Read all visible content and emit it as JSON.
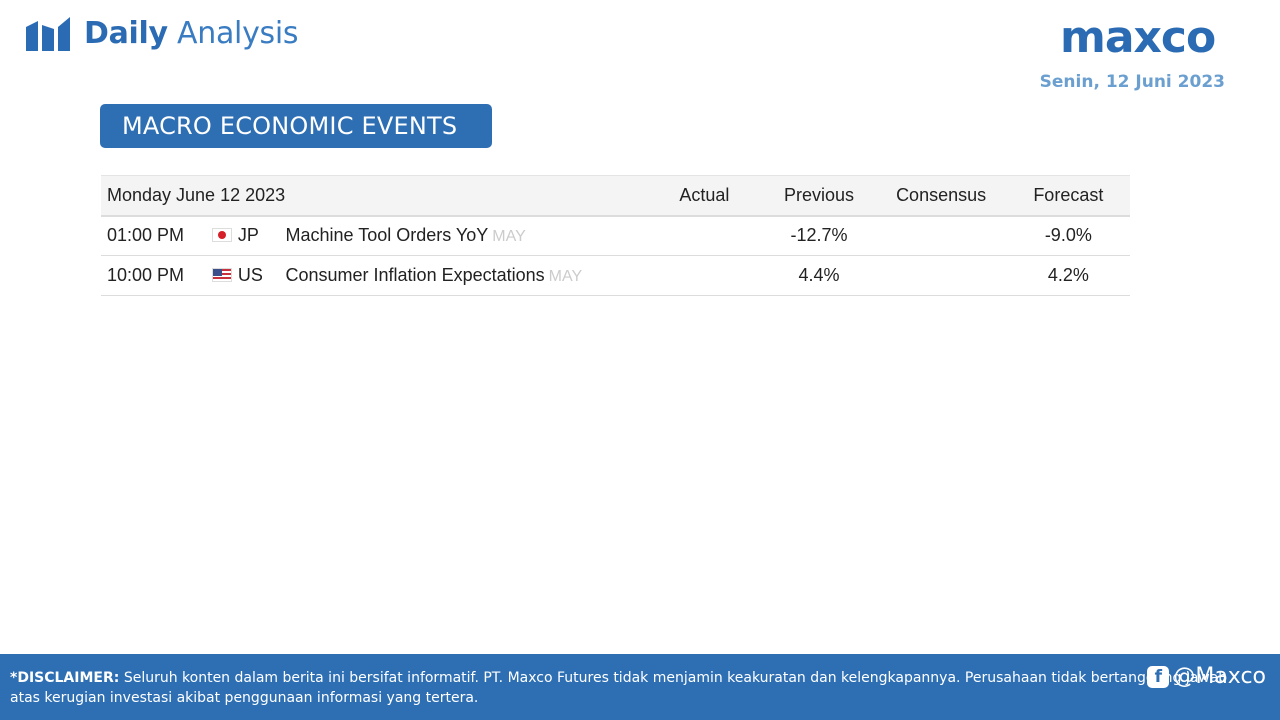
{
  "header": {
    "title_bold": "Daily",
    "title_light": "Analysis",
    "logo": "maxco",
    "date": "Senin, 12 Juni 2023"
  },
  "section": {
    "title": "MACRO ECONOMIC EVENTS"
  },
  "calendar": {
    "day": "Monday June 12 2023",
    "columns": {
      "actual": "Actual",
      "previous": "Previous",
      "consensus": "Consensus",
      "forecast": "Forecast"
    },
    "rows": [
      {
        "time": "01:00 PM",
        "country": "JP",
        "flag_icon": "japan-flag-icon",
        "event": "Machine Tool Orders YoY",
        "period": "MAY",
        "actual": "",
        "previous": "-12.7%",
        "consensus": "",
        "forecast": "-9.0%"
      },
      {
        "time": "10:00 PM",
        "country": "US",
        "flag_icon": "us-flag-icon",
        "event": "Consumer Inflation Expectations",
        "period": "MAY",
        "actual": "",
        "previous": "4.4%",
        "consensus": "",
        "forecast": "4.2%"
      }
    ]
  },
  "footer": {
    "disclaimer_label": "*DISCLAIMER:",
    "disclaimer_text": "Seluruh konten dalam berita ini bersifat informatif. PT. Maxco Futures tidak menjamin keakuratan dan kelengkapannya. Perusahaan tidak bertanggung jawab atas kerugian investasi akibat penggunaan informasi yang tertera.",
    "social_handle": "@Maxco"
  },
  "colors": {
    "brand": "#2e6fb4",
    "negative": "#a31d1d",
    "positive": "#2f7a1f"
  }
}
